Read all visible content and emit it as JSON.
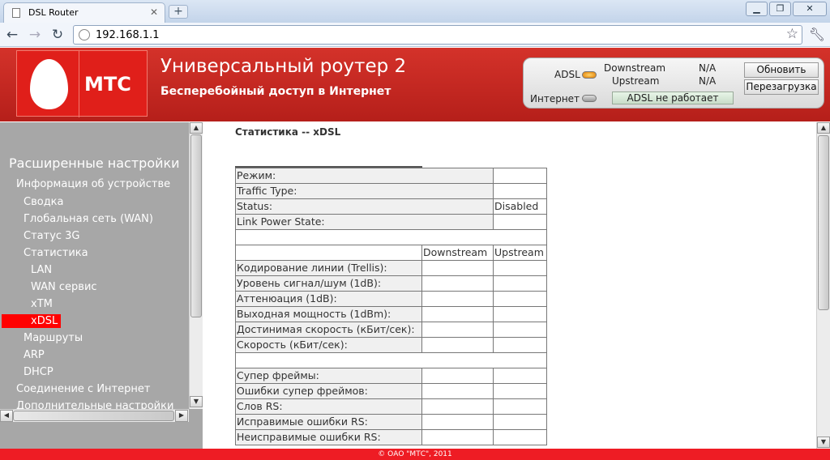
{
  "browser": {
    "tab_title": "DSL Router",
    "url": "192.168.1.1",
    "icons": [
      "back-icon",
      "forward-icon",
      "reload-icon",
      "star-icon",
      "wrench-icon",
      "globe-icon"
    ]
  },
  "header": {
    "logo_text": "МТС",
    "title": "Универсальный роутер 2",
    "subtitle": "Бесперебойный доступ в Интернет",
    "status": {
      "adsl_label": "ADSL",
      "internet_label": "Интернет",
      "downstream_label": "Downstream",
      "upstream_label": "Upstream",
      "downstream_value": "N/A",
      "upstream_value": "N/A",
      "adsl_state": "ADSL не работает",
      "refresh_button": "Обновить",
      "reboot_button": "Перезагрузка"
    },
    "colors": {
      "brand_red": "#e01f1a",
      "adsl_led": "#e07b00"
    }
  },
  "sidebar": {
    "heading": "Расширенные настройки",
    "items": [
      {
        "label": "Информация об устройстве",
        "level": 1
      },
      {
        "label": "Сводка",
        "level": 2
      },
      {
        "label": "Глобальная сеть (WAN)",
        "level": 2
      },
      {
        "label": "Статус 3G",
        "level": 2
      },
      {
        "label": "Статистика",
        "level": 2
      },
      {
        "label": "LAN",
        "level": 3
      },
      {
        "label": "WAN сервис",
        "level": 3
      },
      {
        "label": "xTM",
        "level": 3
      },
      {
        "label": "xDSL",
        "level": 3,
        "active": true
      },
      {
        "label": "Маршруты",
        "level": 2
      },
      {
        "label": "ARP",
        "level": 2
      },
      {
        "label": "DHCP",
        "level": 2
      },
      {
        "label": "Соединение с Интернет",
        "level": 1
      },
      {
        "label": "Дополнительные настройки",
        "level": 1
      }
    ]
  },
  "main": {
    "title": "Статистика -- xDSL",
    "general": [
      {
        "label": "Режим:",
        "value": ""
      },
      {
        "label": "Traffic Type:",
        "value": ""
      },
      {
        "label": "Status:",
        "value": "Disabled"
      },
      {
        "label": "Link Power State:",
        "value": ""
      }
    ],
    "columns": [
      "Downstream",
      "Upstream"
    ],
    "line_rows": [
      "Кодирование линии (Trellis):",
      "Уровень сигнал/шум (1dB):",
      "Аттенюация (1dB):",
      "Выходная мощность (1dBm):",
      "Достинимая скорость (кБит/сек):",
      "Скорость (кБит/сек):"
    ],
    "error_rows": [
      "Супер фреймы:",
      "Ошибки супер фреймов:",
      "Слов RS:",
      "Исправимые ошибки RS:",
      "Неисправимые ошибки RS:"
    ]
  },
  "footer": {
    "text": "© ОАО \"МТС\", 2011"
  }
}
